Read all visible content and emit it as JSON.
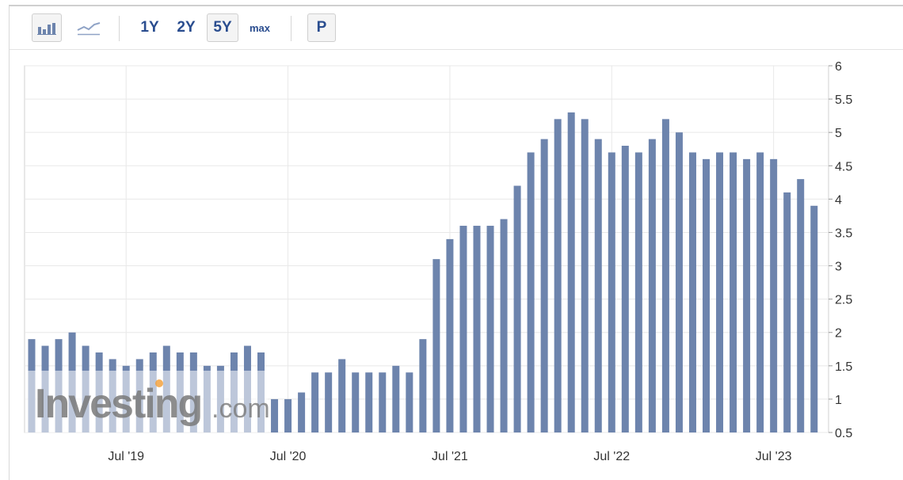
{
  "toolbar": {
    "bar_chart_button": "bar-chart-icon",
    "line_chart_button": "line-chart-icon",
    "range_1y": "1Y",
    "range_2y": "2Y",
    "range_5y": "5Y",
    "range_max": "max",
    "p_button": "P",
    "selected_range": "5Y"
  },
  "watermark": {
    "brand": "Investing",
    "suffix": ".com"
  },
  "colors": {
    "bar": "#6d84ad",
    "grid": "#e8e8e8",
    "axis_text": "#333333",
    "brand_blue": "#2a4d8f"
  },
  "chart_data": {
    "type": "bar",
    "title": "",
    "xlabel": "",
    "ylabel": "",
    "ylim": [
      0.5,
      6
    ],
    "yticks": [
      "0.5",
      "1",
      "1.5",
      "2",
      "2.5",
      "3",
      "3.5",
      "4",
      "4.5",
      "5",
      "5.5",
      "6"
    ],
    "yaxis_position": "right",
    "grid": true,
    "xtick_labels": [
      {
        "label": "Jul '19",
        "index": 7
      },
      {
        "label": "Jul '20",
        "index": 19
      },
      {
        "label": "Jul '21",
        "index": 31
      },
      {
        "label": "Jul '22",
        "index": 43
      },
      {
        "label": "Jul '23",
        "index": 55
      }
    ],
    "categories": [
      "Dec '18",
      "Jan '19",
      "Feb '19",
      "Mar '19",
      "Apr '19",
      "May '19",
      "Jun '19",
      "Jul '19",
      "Aug '19",
      "Sep '19",
      "Oct '19",
      "Nov '19",
      "Dec '19",
      "Jan '20",
      "Feb '20",
      "Mar '20",
      "Apr '20",
      "May '20",
      "Jun '20",
      "Jul '20",
      "Aug '20",
      "Sep '20",
      "Oct '20",
      "Nov '20",
      "Dec '20",
      "Jan '21",
      "Feb '21",
      "Mar '21",
      "Apr '21",
      "May '21",
      "Jun '21",
      "Jul '21",
      "Aug '21",
      "Sep '21",
      "Oct '21",
      "Nov '21",
      "Dec '21",
      "Jan '22",
      "Feb '22",
      "Mar '22",
      "Apr '22",
      "May '22",
      "Jun '22",
      "Jul '22",
      "Aug '22",
      "Sep '22",
      "Oct '22",
      "Nov '22",
      "Dec '22",
      "Jan '23",
      "Feb '23",
      "Mar '23",
      "Apr '23",
      "May '23",
      "Jun '23",
      "Jul '23",
      "Aug '23",
      "Sep '23",
      "Oct '23"
    ],
    "values": [
      1.9,
      1.8,
      1.9,
      2.0,
      1.8,
      1.7,
      1.6,
      1.5,
      1.6,
      1.7,
      1.8,
      1.7,
      1.7,
      1.5,
      1.5,
      1.7,
      1.8,
      1.7,
      1.0,
      1.0,
      1.1,
      1.4,
      1.4,
      1.6,
      1.4,
      1.4,
      1.4,
      1.5,
      1.4,
      1.9,
      3.1,
      3.4,
      3.6,
      3.6,
      3.6,
      3.7,
      4.2,
      4.7,
      4.9,
      5.2,
      5.3,
      5.2,
      4.9,
      4.7,
      4.8,
      4.7,
      4.9,
      5.2,
      5.0,
      4.7,
      4.6,
      4.7,
      4.7,
      4.6,
      4.7,
      4.6,
      4.1,
      4.3,
      3.9
    ]
  }
}
